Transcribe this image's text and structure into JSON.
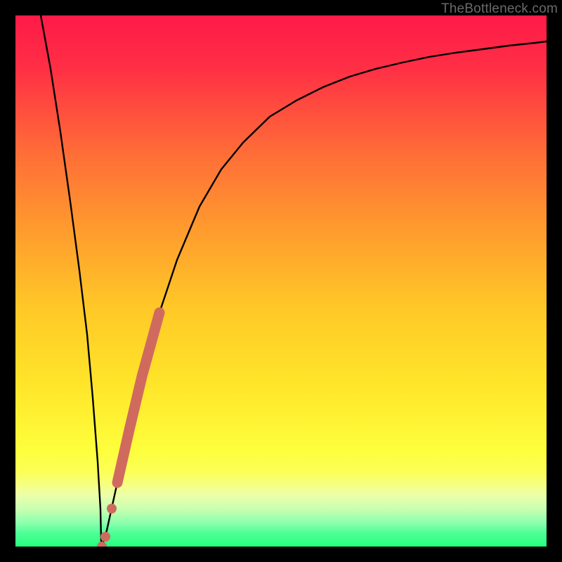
{
  "watermark": "TheBottleneck.com",
  "colors": {
    "bg_black": "#000000",
    "grad_top": "#ff1a3f",
    "grad_mid1": "#ff8a2a",
    "grad_mid2": "#ffd823",
    "grad_mid3": "#fdff45",
    "grad_band": "#f6ff8c",
    "grad_green": "#2bff7d",
    "curve": "#000000",
    "marker": "#d06a5f"
  },
  "chart_data": {
    "type": "line",
    "title": "",
    "xlabel": "",
    "ylabel": "",
    "xlim": [
      0,
      100
    ],
    "ylim": [
      0,
      100
    ],
    "series": [
      {
        "name": "bottleneck-curve",
        "x": [
          5,
          6,
          7,
          8,
          9,
          10,
          11,
          12,
          13,
          14,
          15,
          16,
          18,
          20,
          22,
          25,
          28,
          32,
          36,
          40,
          45,
          50,
          55,
          60,
          65,
          70,
          75,
          80,
          85,
          90,
          95,
          100
        ],
        "values": [
          100,
          90,
          78,
          65,
          52,
          40,
          28,
          16,
          7,
          1,
          0,
          3,
          12,
          22,
          32,
          44,
          54,
          64,
          71,
          76,
          81,
          84,
          86.5,
          88.5,
          90,
          91.2,
          92.2,
          93,
          93.7,
          94.3,
          94.8,
          95.2
        ]
      }
    ],
    "markers": [
      {
        "name": "min-point",
        "x": 15,
        "y": 0
      },
      {
        "name": "segment-start",
        "x": 17.5,
        "y": 9
      },
      {
        "name": "segment-end",
        "x": 25,
        "y": 44
      }
    ],
    "green_band_y": 2,
    "yellow_band_y": 14
  }
}
